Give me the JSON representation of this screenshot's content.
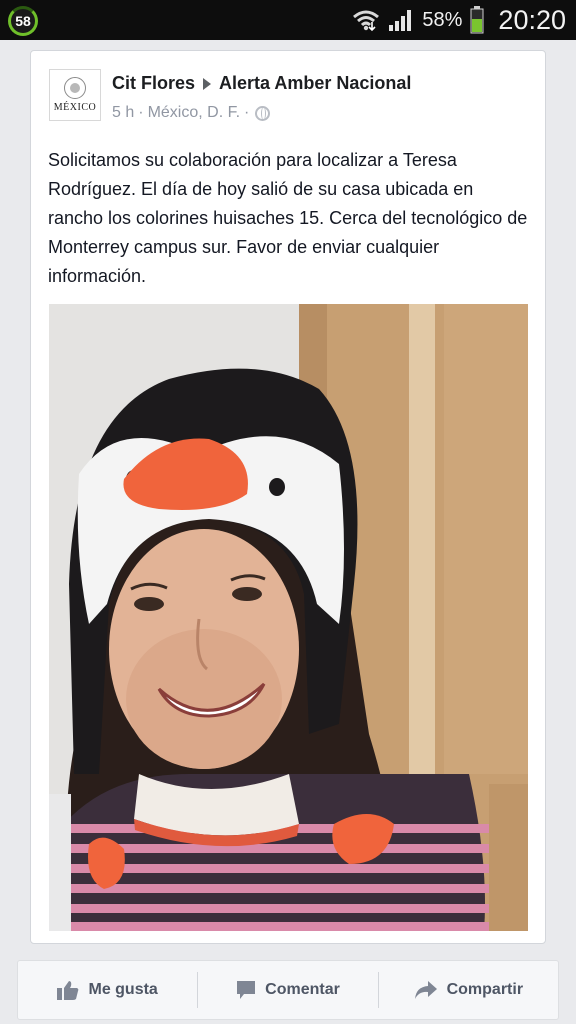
{
  "statusbar": {
    "badge": "58",
    "battery_percent": "58%",
    "time": "20:20"
  },
  "post": {
    "author": "Cit Flores",
    "target": "Alerta Amber Nacional",
    "time": "5 h",
    "separator": "·",
    "location": "México, D. F.",
    "separator2": "·",
    "avatar_text": "MÉXICO",
    "body": "Solicitamos su colaboración para localizar a Teresa Rodríguez. El día de hoy salió de su casa ubicada en rancho los colorines huisaches 15. Cerca del tecnológico de Monterrey campus sur. Favor de enviar cualquier información."
  },
  "actions": {
    "like": "Me gusta",
    "comment": "Comentar",
    "share": "Compartir"
  },
  "icons": [
    "sync-badge-icon",
    "wifi-icon",
    "signal-icon",
    "battery-icon",
    "globe-icon",
    "like-icon",
    "comment-icon",
    "share-icon"
  ],
  "colors": {
    "accent_green": "#6fbf2a",
    "text_primary": "#141823",
    "text_meta": "#9197a3",
    "action_text": "#4e5665"
  }
}
